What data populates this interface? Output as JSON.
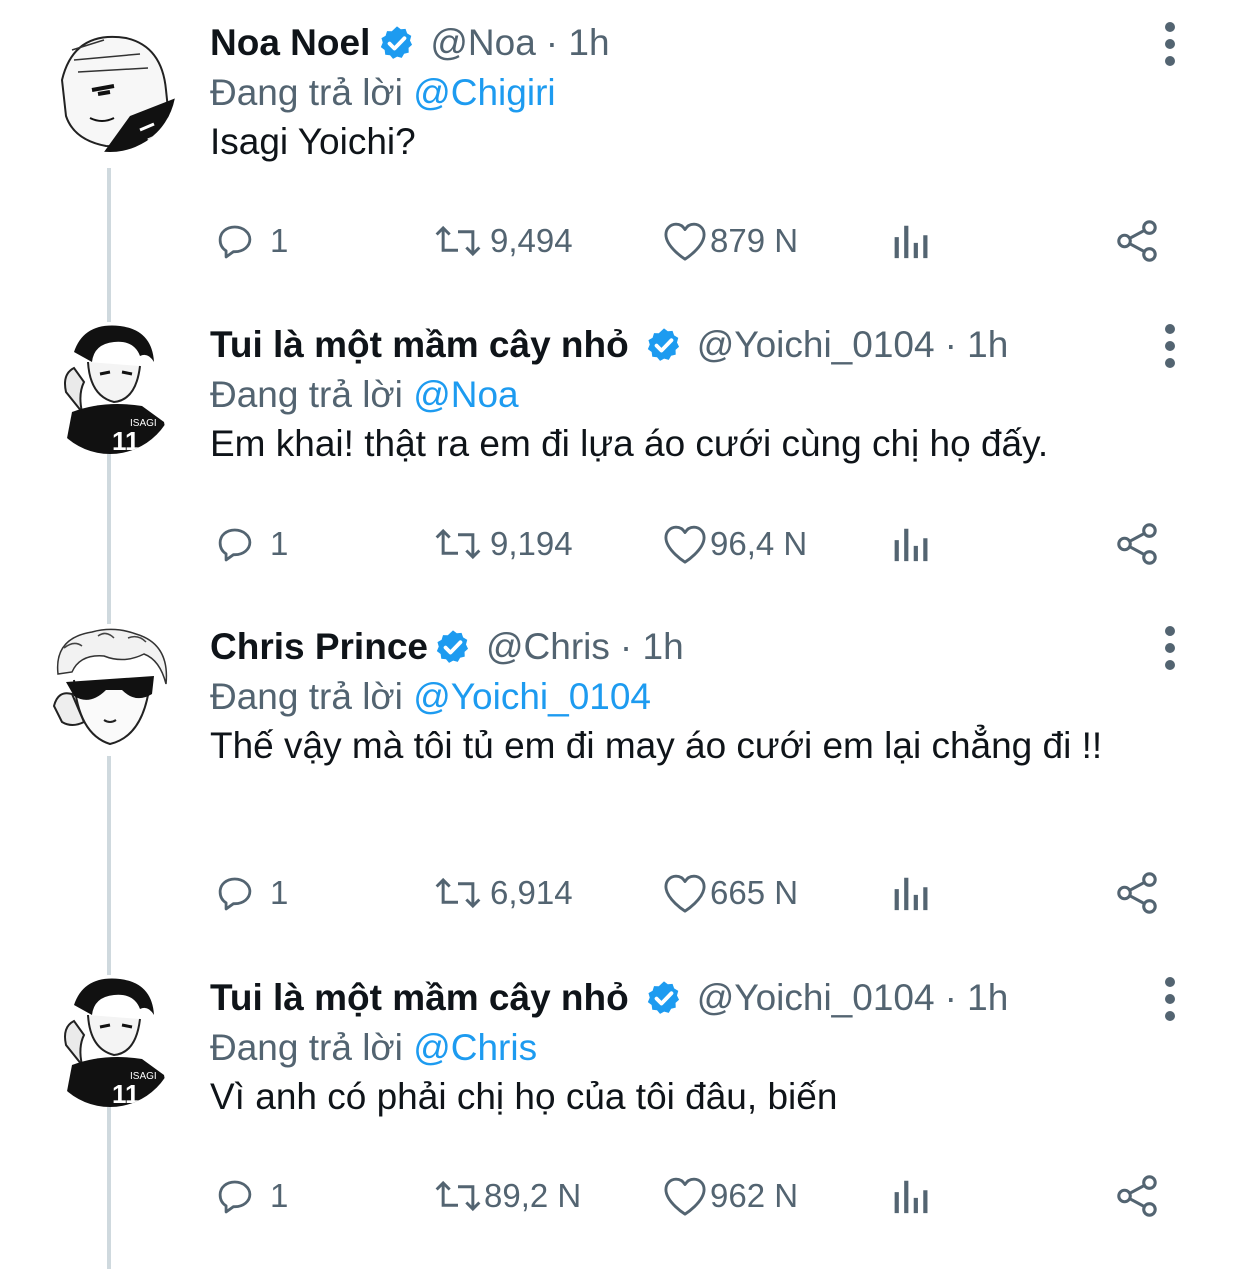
{
  "thread": {
    "reply_prefix": "Đang trả lời",
    "tweets": [
      {
        "author": "Noa Noel",
        "handle": "@Noa",
        "time": "· 1h",
        "replying_to": "@Chigiri",
        "text": "Isagi Yoichi?",
        "stats": {
          "replies": "1",
          "retweets": "9,494",
          "likes": "879 N"
        }
      },
      {
        "author": "Tui là một mầm cây nhỏ",
        "handle": "@Yoichi_0104",
        "time": "· 1h",
        "replying_to": "@Noa",
        "text": "Em khai! thật ra em đi lựa áo cưới cùng chị họ đấy.",
        "stats": {
          "replies": "1",
          "retweets": "9,194",
          "likes": "96,4 N"
        }
      },
      {
        "author": "Chris Prince",
        "handle": "@Chris",
        "time": "· 1h",
        "replying_to": "@Yoichi_0104",
        "text": "Thế vậy mà tôi tủ em đi may áo cưới em lại chẳng đi !!",
        "stats": {
          "replies": "1",
          "retweets": "6,914",
          "likes": "665 N"
        }
      },
      {
        "author": "Tui là một mầm cây nhỏ",
        "handle": "@Yoichi_0104",
        "time": "· 1h",
        "replying_to": "@Chris",
        "text": "Vì anh có phải chị họ của tôi đâu, biến",
        "stats": {
          "replies": "1",
          "retweets": "89,2 N",
          "likes": "962 N"
        }
      }
    ]
  },
  "colors": {
    "text": "#0f1419",
    "secondary": "#536471",
    "accent": "#1d9bf0",
    "thread_line": "#cfd9de"
  },
  "icons": {
    "reply": "speech-bubble-icon",
    "retweet": "retweet-icon",
    "like": "heart-icon",
    "views": "bar-chart-icon",
    "share": "share-icon",
    "more": "vertical-dots-icon",
    "verified": "verified-badge-icon"
  }
}
